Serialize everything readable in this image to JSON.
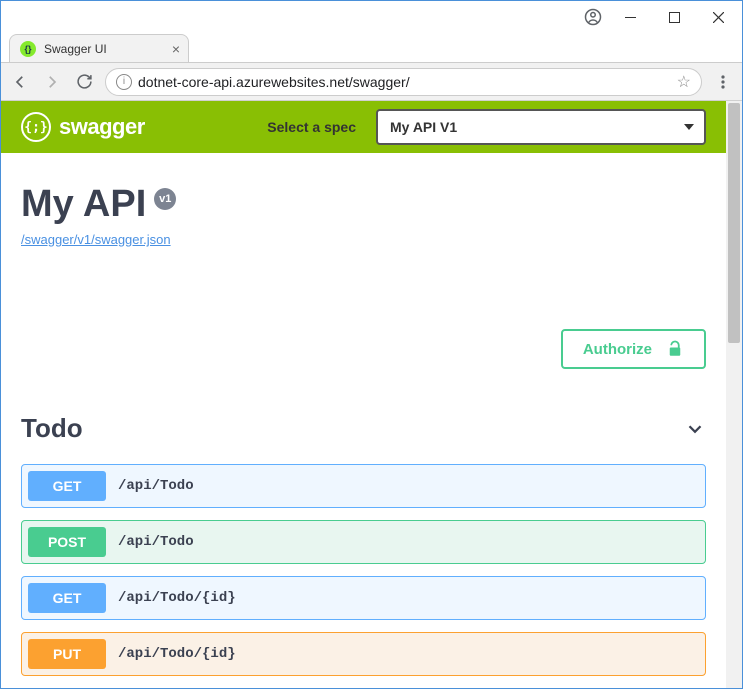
{
  "window": {
    "tab_title": "Swagger UI",
    "url": "dotnet-core-api.azurewebsites.net/swagger/"
  },
  "header": {
    "logo_text": "swagger",
    "spec_label": "Select a spec",
    "spec_selected": "My API V1"
  },
  "api": {
    "title": "My API",
    "version": "v1",
    "definition_link": "/swagger/v1/swagger.json",
    "authorize_label": "Authorize"
  },
  "section": {
    "name": "Todo",
    "operations": [
      {
        "method": "GET",
        "path": "/api/Todo"
      },
      {
        "method": "POST",
        "path": "/api/Todo"
      },
      {
        "method": "GET",
        "path": "/api/Todo/{id}"
      },
      {
        "method": "PUT",
        "path": "/api/Todo/{id}"
      }
    ]
  }
}
